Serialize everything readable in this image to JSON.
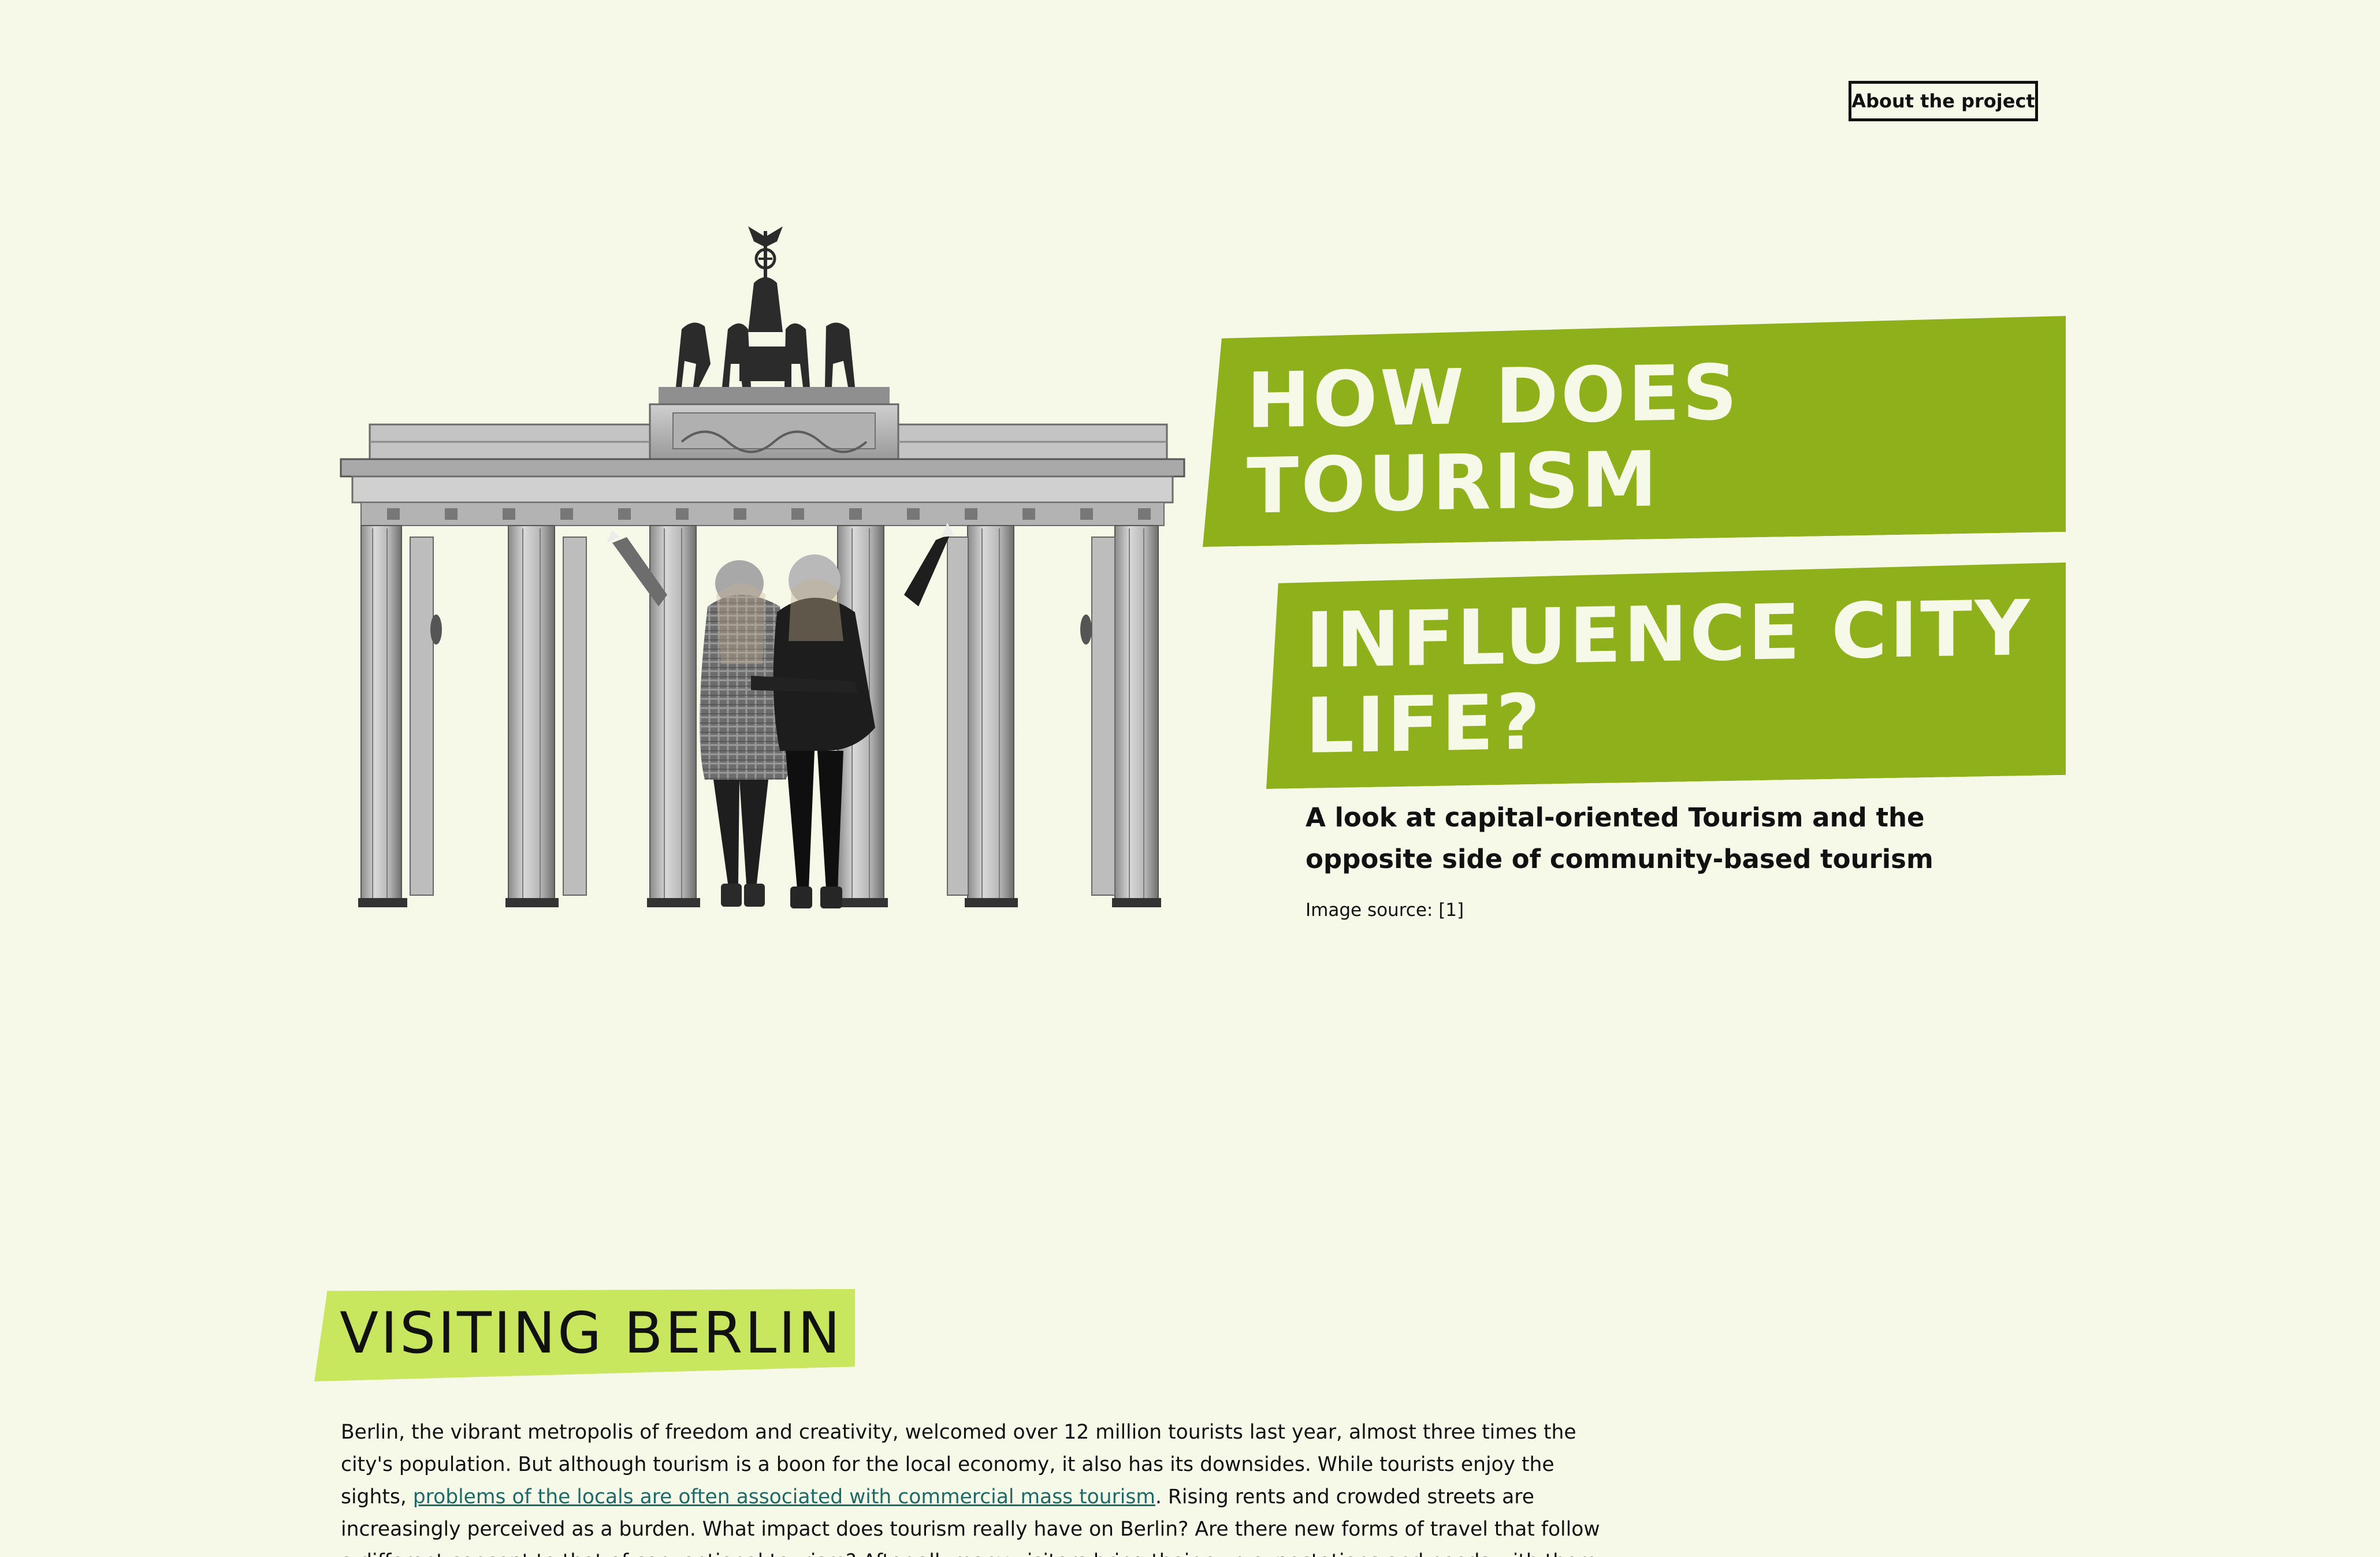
{
  "nav": {
    "about_label": "About the project"
  },
  "hero": {
    "image_icon": "brandenburg-gate-tourists-illustration",
    "title_line_1": "HOW DOES",
    "title_line_2": "TOURISM",
    "title_line_3": "INFLUENCE CITY",
    "title_line_4": "LIFE?",
    "subtitle": "A look at capital-oriented Tourism and the opposite side of community-based tourism",
    "image_source_label": "Image source: ",
    "image_source_ref": "[1]"
  },
  "section": {
    "heading": "VISITING BERLIN",
    "para_part_1": "Berlin, the vibrant metropolis of freedom and creativity, welcomed over 12 million tourists last year, almost three times the city's population. But although tourism is a boon for the local economy, it also has its downsides. While tourists enjoy the sights, ",
    "para_link": "problems of the locals are often associated with commercial mass tourism",
    "para_part_2": ". Rising rents and crowded streets are increasingly perceived as a burden. What impact does tourism really have on Berlin? Are there new forms of travel that follow a different concept to that of conventional tourism? After all, many visitors bring their own expectations and needs with them – this extended a new specific footprint in the city but"
  },
  "colors": {
    "background": "#f6f9e8",
    "banner_green": "#8db01b",
    "section_green": "#c8e65e",
    "link": "#1d6a68"
  }
}
